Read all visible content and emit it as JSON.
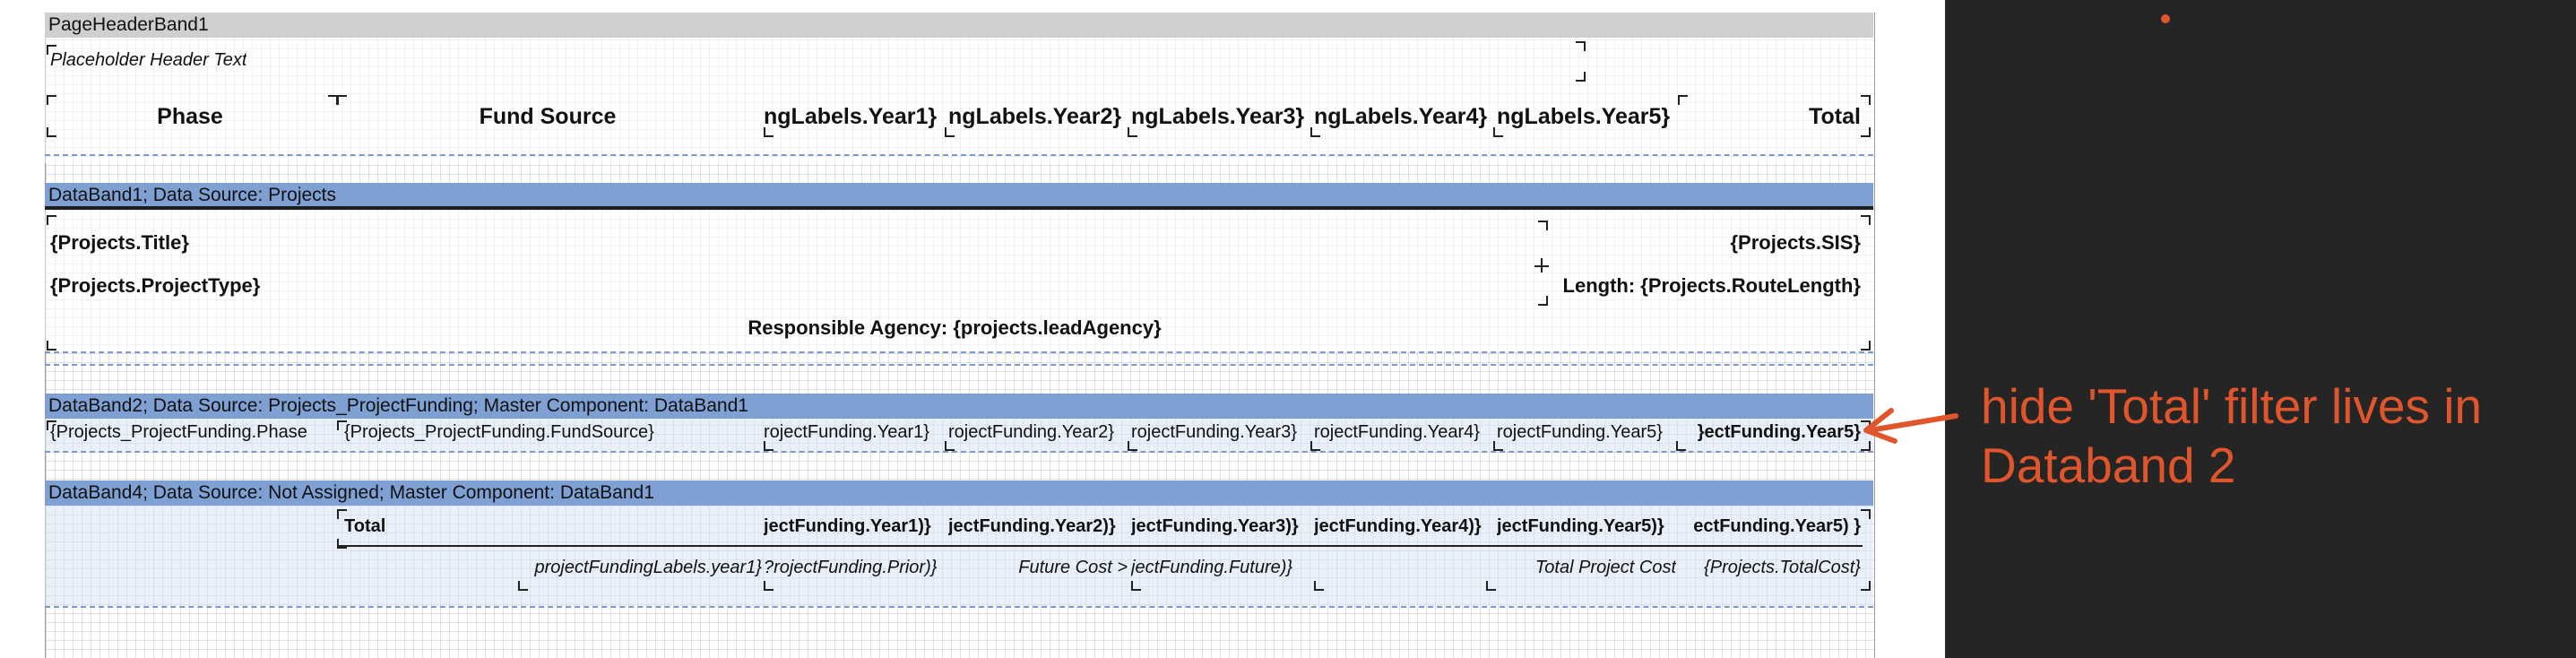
{
  "colors": {
    "band_header": "#cfcfcf",
    "band_data": "#7ea0d3",
    "annotation": "#e0552b",
    "panel": "#252525"
  },
  "page_header": {
    "band_label": "PageHeaderBand1",
    "placeholder": "Placeholder Header Text",
    "columns": [
      "Phase",
      "Fund Source",
      "ngLabels.Year1}",
      "ngLabels.Year2}",
      "ngLabels.Year3}",
      "ngLabels.Year4}",
      "ngLabels.Year5}",
      "Total"
    ]
  },
  "databand1": {
    "band_label": "DataBand1; Data Source: Projects",
    "title": "{Projects.Title}",
    "sis": "{Projects.SIS}",
    "project_type": "{Projects.ProjectType}",
    "route_length": "Length: {Projects.RouteLength}",
    "agency": "Responsible Agency: {projects.leadAgency}"
  },
  "databand2": {
    "band_label": "DataBand2; Data Source: Projects_ProjectFunding; Master Component: DataBand1",
    "cells": [
      "{Projects_ProjectFunding.Phase",
      "{Projects_ProjectFunding.FundSource}",
      "rojectFunding.Year1}",
      "rojectFunding.Year2}",
      "rojectFunding.Year3}",
      "rojectFunding.Year4}",
      "rojectFunding.Year5}",
      "}ectFunding.Year5}"
    ]
  },
  "databand4": {
    "band_label": "DataBand4; Data Source: Not Assigned; Master Component: DataBand1",
    "total_label": "Total",
    "totals": [
      "jectFunding.Year1)}",
      "jectFunding.Year2)}",
      "jectFunding.Year3)}",
      "jectFunding.Year4)}",
      "jectFunding.Year5)}",
      "ectFunding.Year5) }"
    ],
    "labels_year1": "projectFundingLabels.year1}",
    "prior": "?rojectFunding.Prior)}",
    "future_label": "Future Cost >",
    "future": "jectFunding.Future)}",
    "total_project_cost_label": "Total Project Cost",
    "total_cost": "{Projects.TotalCost}"
  },
  "annotation": {
    "line1": "hide 'Total' filter lives in",
    "line2": "Databand 2"
  }
}
